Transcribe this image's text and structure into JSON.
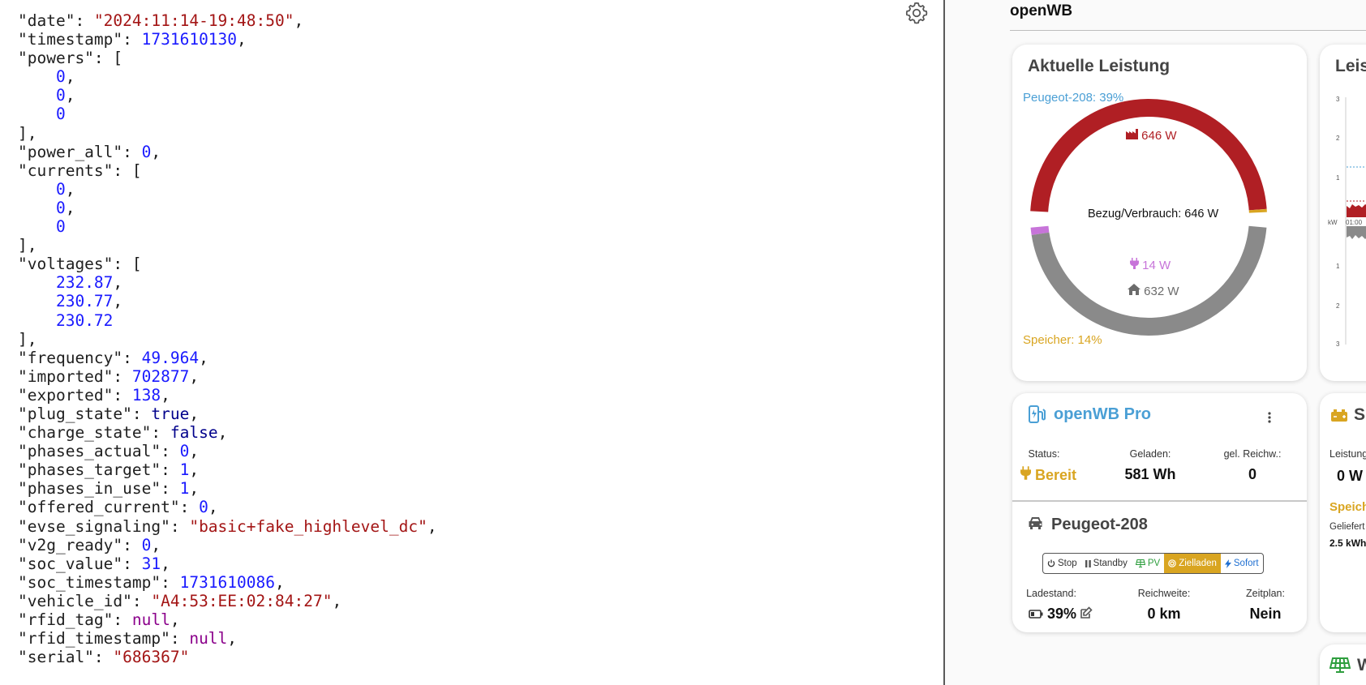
{
  "json_viewer": {
    "lines": [
      [
        [
          "\"date\"",
          "k"
        ],
        [
          ": ",
          ""
        ],
        [
          "\"2024:11:14-19:48:50\"",
          "s"
        ],
        [
          ",",
          ""
        ]
      ],
      [
        [
          "\"timestamp\"",
          "k"
        ],
        [
          ": ",
          ""
        ],
        [
          "1731610130",
          "n"
        ],
        [
          ",",
          ""
        ]
      ],
      [
        [
          "\"powers\"",
          "k"
        ],
        [
          ": [",
          ""
        ]
      ],
      [
        [
          "    ",
          ""
        ],
        [
          "0",
          "n"
        ],
        [
          ",",
          ""
        ]
      ],
      [
        [
          "    ",
          ""
        ],
        [
          "0",
          "n"
        ],
        [
          ",",
          ""
        ]
      ],
      [
        [
          "    ",
          ""
        ],
        [
          "0",
          "n"
        ]
      ],
      [
        [
          "],",
          ""
        ]
      ],
      [
        [
          "\"power_all\"",
          "k"
        ],
        [
          ": ",
          ""
        ],
        [
          "0",
          "n"
        ],
        [
          ",",
          ""
        ]
      ],
      [
        [
          "\"currents\"",
          "k"
        ],
        [
          ": [",
          ""
        ]
      ],
      [
        [
          "    ",
          ""
        ],
        [
          "0",
          "n"
        ],
        [
          ",",
          ""
        ]
      ],
      [
        [
          "    ",
          ""
        ],
        [
          "0",
          "n"
        ],
        [
          ",",
          ""
        ]
      ],
      [
        [
          "    ",
          ""
        ],
        [
          "0",
          "n"
        ]
      ],
      [
        [
          "],",
          ""
        ]
      ],
      [
        [
          "\"voltages\"",
          "k"
        ],
        [
          ": [",
          ""
        ]
      ],
      [
        [
          "    ",
          ""
        ],
        [
          "232.87",
          "n"
        ],
        [
          ",",
          ""
        ]
      ],
      [
        [
          "    ",
          ""
        ],
        [
          "230.77",
          "n"
        ],
        [
          ",",
          ""
        ]
      ],
      [
        [
          "    ",
          ""
        ],
        [
          "230.72",
          "n"
        ]
      ],
      [
        [
          "],",
          ""
        ]
      ],
      [
        [
          "\"frequency\"",
          "k"
        ],
        [
          ": ",
          ""
        ],
        [
          "49.964",
          "n"
        ],
        [
          ",",
          ""
        ]
      ],
      [
        [
          "\"imported\"",
          "k"
        ],
        [
          ": ",
          ""
        ],
        [
          "702877",
          "n"
        ],
        [
          ",",
          ""
        ]
      ],
      [
        [
          "\"exported\"",
          "k"
        ],
        [
          ": ",
          ""
        ],
        [
          "138",
          "n"
        ],
        [
          ",",
          ""
        ]
      ],
      [
        [
          "\"plug_state\"",
          "k"
        ],
        [
          ": ",
          ""
        ],
        [
          "true",
          "b"
        ],
        [
          ",",
          ""
        ]
      ],
      [
        [
          "\"charge_state\"",
          "k"
        ],
        [
          ": ",
          ""
        ],
        [
          "false",
          "b"
        ],
        [
          ",",
          ""
        ]
      ],
      [
        [
          "\"phases_actual\"",
          "k"
        ],
        [
          ": ",
          ""
        ],
        [
          "0",
          "n"
        ],
        [
          ",",
          ""
        ]
      ],
      [
        [
          "\"phases_target\"",
          "k"
        ],
        [
          ": ",
          ""
        ],
        [
          "1",
          "n"
        ],
        [
          ",",
          ""
        ]
      ],
      [
        [
          "\"phases_in_use\"",
          "k"
        ],
        [
          ": ",
          ""
        ],
        [
          "1",
          "n"
        ],
        [
          ",",
          ""
        ]
      ],
      [
        [
          "\"offered_current\"",
          "k"
        ],
        [
          ": ",
          ""
        ],
        [
          "0",
          "n"
        ],
        [
          ",",
          ""
        ]
      ],
      [
        [
          "\"evse_signaling\"",
          "k"
        ],
        [
          ": ",
          ""
        ],
        [
          "\"basic+fake_highlevel_dc\"",
          "s"
        ],
        [
          ",",
          ""
        ]
      ],
      [
        [
          "\"v2g_ready\"",
          "k"
        ],
        [
          ": ",
          ""
        ],
        [
          "0",
          "n"
        ],
        [
          ",",
          ""
        ]
      ],
      [
        [
          "\"soc_value\"",
          "k"
        ],
        [
          ": ",
          ""
        ],
        [
          "31",
          "n"
        ],
        [
          ",",
          ""
        ]
      ],
      [
        [
          "\"soc_timestamp\"",
          "k"
        ],
        [
          ": ",
          ""
        ],
        [
          "1731610086",
          "n"
        ],
        [
          ",",
          ""
        ]
      ],
      [
        [
          "\"vehicle_id\"",
          "k"
        ],
        [
          ": ",
          ""
        ],
        [
          "\"A4:53:EE:02:84:27\"",
          "s"
        ],
        [
          ",",
          ""
        ]
      ],
      [
        [
          "\"rfid_tag\"",
          "k"
        ],
        [
          ": ",
          ""
        ],
        [
          "null",
          "z"
        ],
        [
          ",",
          ""
        ]
      ],
      [
        [
          "\"rfid_timestamp\"",
          "k"
        ],
        [
          ": ",
          ""
        ],
        [
          "null",
          "z"
        ],
        [
          ",",
          ""
        ]
      ],
      [
        [
          "\"serial\"",
          "k"
        ],
        [
          ": ",
          ""
        ],
        [
          "\"686367\"",
          "s"
        ]
      ]
    ]
  },
  "openwb": {
    "title": "openWB",
    "power_card": {
      "title": "Aktuelle Leistung",
      "vehicle_soc_label": "Peugeot-208: 39%",
      "center_label": "Bezug/Verbrauch: 646 W",
      "grid_value": "646 W",
      "charge_value": "14 W",
      "house_value": "632 W",
      "storage_soc_label": "Speicher: 14%",
      "grid_power_w": 646,
      "charge_power_w": 14,
      "house_power_w": 632,
      "colors": {
        "grid": "#b01f24",
        "house": "#8a8a8a",
        "charge": "#c774d9",
        "vehicle": "#4a9fd5",
        "storage": "#d9a521"
      }
    },
    "chart_card": {
      "title_partial": "Leist"
    },
    "chargepoint": {
      "name": "openWB Pro",
      "status_label": "Status:",
      "status_value": "Bereit",
      "charged_label": "Geladen:",
      "charged_value": "581 Wh",
      "range_label": "gel. Reichw.:",
      "range_value": "0",
      "vehicle_name": "Peugeot-208",
      "modes": [
        {
          "label": "Stop",
          "icon": "power-icon",
          "active": false
        },
        {
          "label": "Standby",
          "icon": "pause-icon",
          "active": false
        },
        {
          "label": "PV",
          "icon": "solar-panel-icon",
          "active": false
        },
        {
          "label": "Zielladen",
          "icon": "target-icon",
          "active": true
        },
        {
          "label": "Sofort",
          "icon": "bolt-icon",
          "active": false
        }
      ],
      "soc_label": "Ladestand:",
      "soc_value": "39%",
      "reach_label": "Reichweite:",
      "reach_value": "0 km",
      "plan_label": "Zeitplan:",
      "plan_value": "Nein"
    },
    "speicher_card": {
      "title_partial": "Sp",
      "power_label_partial": "Leistung",
      "power_value": "0 W",
      "section_partial": "Speich",
      "delivered_label_partial": "Geliefert",
      "delivered_value_partial": "2.5 kWh"
    },
    "pv_card": {
      "title_partial": "W"
    }
  }
}
